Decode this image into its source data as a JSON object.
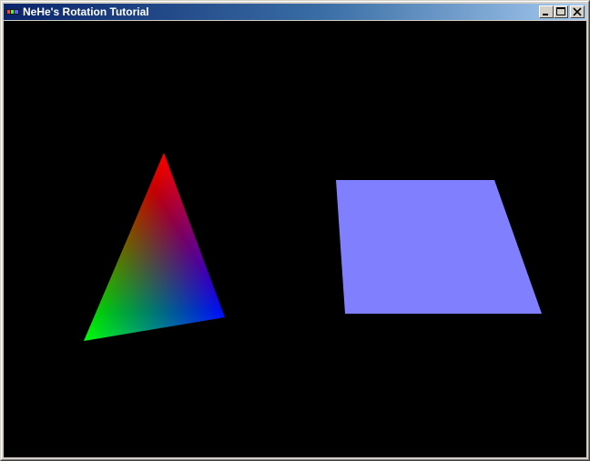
{
  "window": {
    "title": "NeHe's Rotation Tutorial",
    "icon": "opengl-app-icon",
    "buttons": {
      "minimize": "minimize-icon",
      "maximize": "maximize-icon",
      "close": "close-icon"
    }
  },
  "scene": {
    "background": "#000000",
    "triangle": {
      "colors": [
        "#ff0000",
        "#00ff00",
        "#0000ff"
      ]
    },
    "quad": {
      "color": "#8080ff"
    }
  }
}
